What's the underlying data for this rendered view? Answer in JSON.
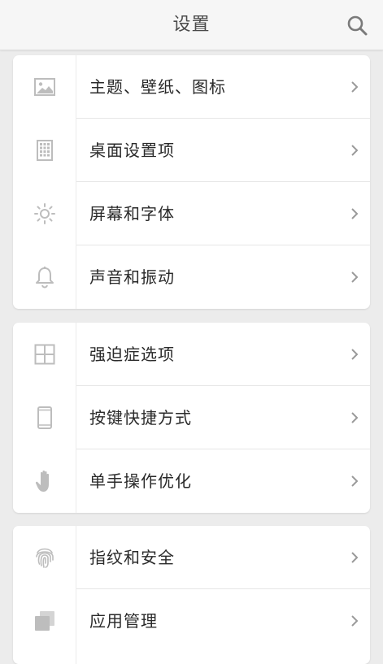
{
  "header": {
    "title": "设置"
  },
  "sections": [
    {
      "items": [
        {
          "label": "主题、壁纸、图标",
          "icon": "image-icon"
        },
        {
          "label": "桌面设置项",
          "icon": "grid-icon"
        },
        {
          "label": "屏幕和字体",
          "icon": "brightness-icon"
        },
        {
          "label": "声音和振动",
          "icon": "bell-icon"
        }
      ]
    },
    {
      "items": [
        {
          "label": "强迫症选项",
          "icon": "window-grid-icon"
        },
        {
          "label": "按键快捷方式",
          "icon": "phone-icon"
        },
        {
          "label": "单手操作优化",
          "icon": "hand-icon"
        }
      ]
    },
    {
      "items": [
        {
          "label": "指纹和安全",
          "icon": "fingerprint-icon"
        },
        {
          "label": "应用管理",
          "icon": "apps-stack-icon"
        }
      ]
    }
  ],
  "colors": {
    "background": "#ececec",
    "card": "#ffffff",
    "icon_gray": "#b8b8b8",
    "text": "#2a2a2a",
    "header_text": "#4a4a4a"
  }
}
